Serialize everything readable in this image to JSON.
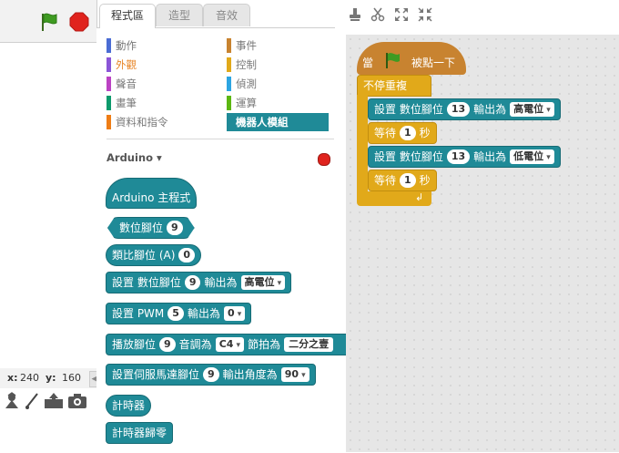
{
  "stage": {
    "coords_x_label": "x:",
    "coords_x": "240",
    "coords_y_label": "y:",
    "coords_y": "160"
  },
  "tabs": [
    "程式區",
    "造型",
    "音效"
  ],
  "categories_left": [
    "動作",
    "外觀",
    "聲音",
    "畫筆",
    "資料和指令"
  ],
  "categories_right": [
    "事件",
    "控制",
    "偵測",
    "運算",
    "機器人模組"
  ],
  "colors": {
    "motion": "#4a6cd4",
    "looks": "#8a55d7",
    "sound": "#bb42c3",
    "pen": "#0e9a6c",
    "data": "#ee7d16",
    "events": "#c88330",
    "control": "#e1a91a",
    "sensing": "#2ca5e2",
    "operators": "#5cb712",
    "robots": "#1f8a97"
  },
  "palette": {
    "extension_name": "Arduino",
    "blocks": [
      {
        "text": "Arduino 主程式"
      },
      {
        "text": "數位腳位",
        "arg": "9"
      },
      {
        "text": "類比腳位 (A)",
        "arg": "0"
      },
      {
        "pre": "設置  數位腳位",
        "arg": "9",
        "mid": "輸出為",
        "drop": "高電位"
      },
      {
        "pre": "設置  PWM",
        "arg": "5",
        "mid": "輸出為",
        "drop": "0"
      },
      {
        "pre": "播放腳位",
        "arg": "9",
        "mid": "音調為",
        "drop": "C4",
        "mid2": "節拍為",
        "drop2": "二分之壹"
      },
      {
        "pre": "設置伺服馬達腳位",
        "arg": "9",
        "mid": "輸出角度為",
        "drop": "90"
      },
      {
        "text": "計時器"
      },
      {
        "text": "計時器歸零"
      }
    ]
  },
  "script": {
    "hat_pre": "當",
    "hat_post": "被點一下",
    "forever": "不停重複",
    "set1": {
      "pre": "設置  數位腳位",
      "arg": "13",
      "mid": "輸出為",
      "drop": "高電位"
    },
    "wait1": {
      "pre": "等待",
      "arg": "1",
      "post": "秒"
    },
    "set2": {
      "pre": "設置  數位腳位",
      "arg": "13",
      "mid": "輸出為",
      "drop": "低電位"
    },
    "wait2": {
      "pre": "等待",
      "arg": "1",
      "post": "秒"
    }
  }
}
